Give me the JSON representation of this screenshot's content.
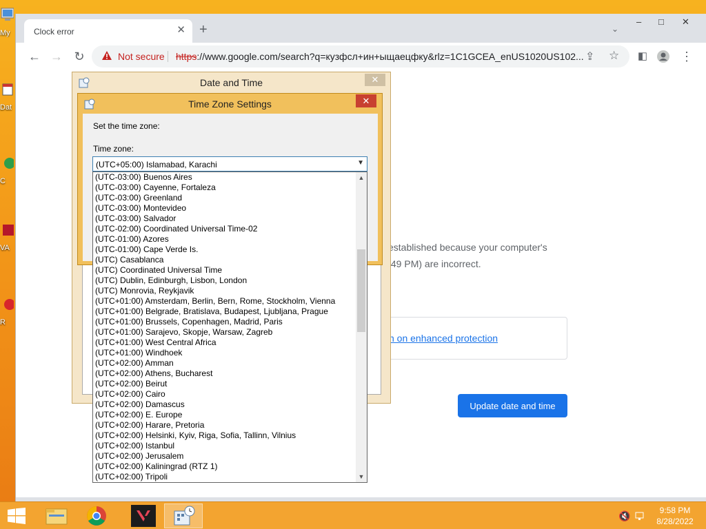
{
  "desktop": {
    "icons": [
      {
        "label": "My"
      },
      {
        "label": "Dat"
      },
      {
        "label": "C"
      },
      {
        "label": "VA"
      },
      {
        "label": "R"
      }
    ]
  },
  "browser": {
    "tab": {
      "title": "Clock error",
      "close_icon": "close-icon"
    },
    "new_tab_label": "+",
    "window_controls": {
      "minimize": "–",
      "maximize": "□",
      "close": "✕"
    },
    "toolbar": {
      "not_secure_label": "Not secure",
      "url_scheme": "https",
      "url_rest": "://www.google.com/search?q=кузфсл+ин+ыщаецфку&rlz=1C1GCEA_enUS1020US102..."
    },
    "page": {
      "error_line1": "established because your computer's",
      "error_line2": ":49 PM) are incorrect.",
      "protection_link": "n on enhanced protection",
      "update_button": "Update date and time"
    }
  },
  "date_time_dialog": {
    "title": "Date and Time",
    "close": "✕"
  },
  "time_zone_dialog": {
    "title": "Time Zone Settings",
    "close": "✕",
    "set_label": "Set the time zone:",
    "zone_label": "Time zone:",
    "selected": "(UTC+05:00) Islamabad, Karachi",
    "options": [
      "(UTC-03:00) Buenos Aires",
      "(UTC-03:00) Cayenne, Fortaleza",
      "(UTC-03:00) Greenland",
      "(UTC-03:00) Montevideo",
      "(UTC-03:00) Salvador",
      "(UTC-02:00) Coordinated Universal Time-02",
      "(UTC-01:00) Azores",
      "(UTC-01:00) Cape Verde Is.",
      "(UTC) Casablanca",
      "(UTC) Coordinated Universal Time",
      "(UTC) Dublin, Edinburgh, Lisbon, London",
      "(UTC) Monrovia, Reykjavik",
      "(UTC+01:00) Amsterdam, Berlin, Bern, Rome, Stockholm, Vienna",
      "(UTC+01:00) Belgrade, Bratislava, Budapest, Ljubljana, Prague",
      "(UTC+01:00) Brussels, Copenhagen, Madrid, Paris",
      "(UTC+01:00) Sarajevo, Skopje, Warsaw, Zagreb",
      "(UTC+01:00) West Central Africa",
      "(UTC+01:00) Windhoek",
      "(UTC+02:00) Amman",
      "(UTC+02:00) Athens, Bucharest",
      "(UTC+02:00) Beirut",
      "(UTC+02:00) Cairo",
      "(UTC+02:00) Damascus",
      "(UTC+02:00) E. Europe",
      "(UTC+02:00) Harare, Pretoria",
      "(UTC+02:00) Helsinki, Kyiv, Riga, Sofia, Tallinn, Vilnius",
      "(UTC+02:00) Istanbul",
      "(UTC+02:00) Jerusalem",
      "(UTC+02:00) Kaliningrad (RTZ 1)",
      "(UTC+02:00) Tripoli"
    ]
  },
  "taskbar": {
    "time": "9:58 PM",
    "date": "8/28/2022",
    "apps": [
      "file-explorer-icon",
      "chrome-icon",
      "valorant-icon",
      "date-time-icon"
    ]
  },
  "colors": {
    "desktop": "#f29418",
    "taskbar": "#f3a430",
    "tz_titlebar": "#f1c05c",
    "accent": "#1a73e8",
    "danger": "#c5221f"
  }
}
